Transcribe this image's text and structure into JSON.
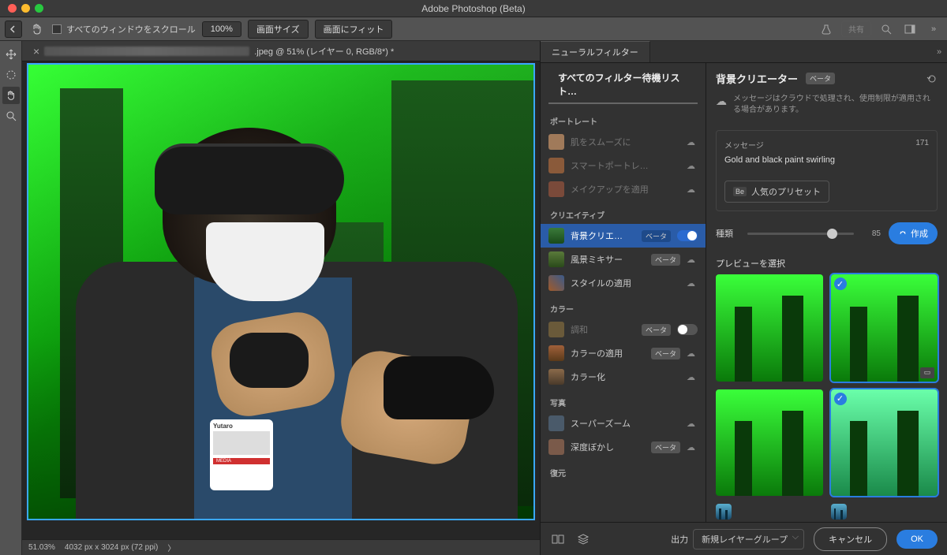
{
  "app": {
    "title": "Adobe Photoshop (Beta)"
  },
  "options_bar": {
    "scroll_all_label": "すべてのウィンドウをスクロール",
    "zoom_pct": "100%",
    "fit_screen": "画面サイズ",
    "fit_image": "画面にフィット",
    "share": "共有"
  },
  "document": {
    "tab_suffix": ".jpeg @ 51% (レイヤー 0, RGB/8*) *",
    "status_zoom": "51.03%",
    "status_dims": "4032 px x 3024 px (72 ppi)",
    "lanyard_name": "Yutaro",
    "lanyard_tag": "MEDIA"
  },
  "panel": {
    "tab": "ニューラルフィルター",
    "list_header": "すべてのフィルター待機リスト…",
    "categories": {
      "portrait": "ポートレート",
      "creative": "クリエイティブ",
      "color": "カラー",
      "photo": "写真",
      "restore": "復元"
    },
    "filters": {
      "skin_smooth": "肌をスムーズに",
      "smart_portrait": "スマートポートレ…",
      "makeup": "メイクアップを適用",
      "bg_creator": "背景クリエ…",
      "landscape_mixer": "風景ミキサー",
      "style_transfer": "スタイルの適用",
      "harmonize": "調和",
      "color_transfer": "カラーの適用",
      "colorize": "カラー化",
      "super_zoom": "スーパーズーム",
      "depth_blur": "深度ぼかし"
    },
    "beta": "ベータ"
  },
  "detail": {
    "title": "背景クリエーター",
    "beta": "ベータ",
    "cloud_note": "メッセージはクラウドで処理され、使用制限が適用される場合があります。",
    "message_label": "メッセージ",
    "message_count": "171",
    "message_value": "Gold and black paint swirling",
    "preset_btn": "人気のプリセット",
    "slider_label": "種類",
    "slider_value": "85",
    "create_btn": "作成",
    "preview_label": "プレビューを選択"
  },
  "footer": {
    "output_label": "出力",
    "output_value": "新規レイヤーグループ",
    "cancel": "キャンセル",
    "ok": "OK"
  }
}
